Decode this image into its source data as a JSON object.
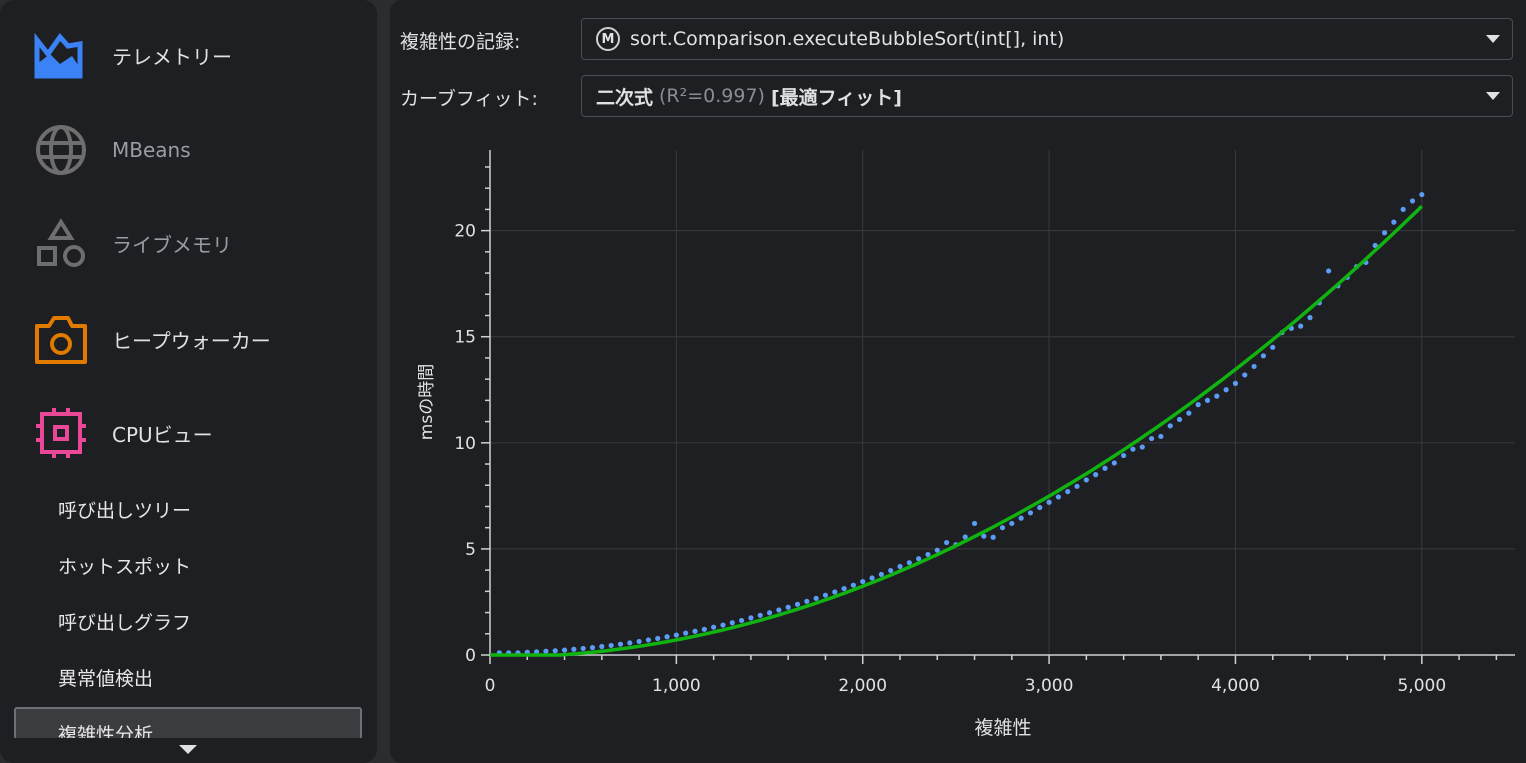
{
  "sidebar": {
    "items": [
      {
        "label": "テレメトリー",
        "icon": "telemetry-icon",
        "color": "#3b82f6"
      },
      {
        "label": "MBeans",
        "icon": "globe-icon",
        "color": "#6e6e6e"
      },
      {
        "label": "ライブメモリ",
        "icon": "shapes-icon",
        "color": "#6e6e6e"
      },
      {
        "label": "ヒープウォーカー",
        "icon": "camera-icon",
        "color": "#e07b00"
      },
      {
        "label": "CPUビュー",
        "icon": "cpu-chip-icon",
        "color": "#ec4899"
      }
    ],
    "sub_items": [
      "呼び出しツリー",
      "ホットスポット",
      "呼び出しグラフ",
      "異常値検出",
      "複雑性分析"
    ],
    "selected": "複雑性分析"
  },
  "controls": {
    "recording_label": "複雑性の記録:",
    "recording_value": "sort.Comparison.executeBubbleSort(int[], int)",
    "method_badge": "M",
    "curve_label": "カーブフィット:",
    "curve_name": "二次式",
    "curve_r2": "(R²=0.997)",
    "curve_best": "[最適フィット]"
  },
  "chart_data": {
    "type": "scatter",
    "xlabel": "複雑性",
    "ylabel": "msの時間",
    "xlim": [
      0,
      5500
    ],
    "ylim": [
      0,
      23.8
    ],
    "xticks": [
      0,
      1000,
      2000,
      3000,
      4000,
      5000
    ],
    "xtick_labels": [
      "0",
      "1,000",
      "2,000",
      "3,000",
      "4,000",
      "5,000"
    ],
    "yticks": [
      0,
      5,
      10,
      15,
      20
    ],
    "grid": true,
    "colors": {
      "points": "#5b9cf5",
      "fit": "#11b311"
    },
    "fit": {
      "model": "quadratic",
      "r2": 0.997,
      "a": 8.6e-07,
      "b": -5e-05,
      "c": -0.1
    },
    "x": [
      50,
      100,
      150,
      200,
      250,
      300,
      350,
      400,
      450,
      500,
      550,
      600,
      650,
      700,
      750,
      800,
      850,
      900,
      950,
      1000,
      1050,
      1100,
      1150,
      1200,
      1250,
      1300,
      1350,
      1400,
      1450,
      1500,
      1550,
      1600,
      1650,
      1700,
      1750,
      1800,
      1850,
      1900,
      1950,
      2000,
      2050,
      2100,
      2150,
      2200,
      2250,
      2300,
      2350,
      2400,
      2450,
      2500,
      2550,
      2600,
      2650,
      2700,
      2750,
      2800,
      2850,
      2900,
      2950,
      3000,
      3050,
      3100,
      3150,
      3200,
      3250,
      3300,
      3350,
      3400,
      3450,
      3500,
      3550,
      3600,
      3650,
      3700,
      3750,
      3800,
      3850,
      3900,
      3950,
      4000,
      4050,
      4100,
      4150,
      4200,
      4250,
      4300,
      4350,
      4400,
      4450,
      4500,
      4550,
      4600,
      4650,
      4700,
      4750,
      4800,
      4850,
      4900,
      4950,
      5000
    ],
    "y": [
      0.1,
      0.1,
      0.1,
      0.13,
      0.15,
      0.18,
      0.2,
      0.23,
      0.27,
      0.31,
      0.35,
      0.4,
      0.45,
      0.51,
      0.57,
      0.64,
      0.71,
      0.78,
      0.86,
      0.94,
      1.03,
      1.12,
      1.21,
      1.31,
      1.41,
      1.52,
      1.63,
      1.75,
      1.87,
      1.99,
      2.12,
      2.25,
      2.39,
      2.53,
      2.67,
      2.82,
      2.97,
      3.13,
      3.29,
      3.46,
      3.63,
      3.8,
      3.98,
      4.17,
      4.35,
      4.54,
      4.74,
      4.94,
      5.3,
      5.2,
      5.56,
      6.2,
      5.6,
      5.55,
      6.0,
      6.2,
      6.45,
      6.7,
      6.95,
      7.2,
      7.45,
      7.7,
      7.95,
      8.25,
      8.5,
      8.8,
      9.05,
      9.4,
      9.7,
      9.8,
      10.2,
      10.3,
      10.8,
      11.1,
      11.4,
      11.8,
      12.0,
      12.2,
      12.5,
      12.8,
      13.2,
      13.6,
      14.1,
      14.5,
      15.2,
      15.4,
      15.5,
      15.9,
      16.6,
      18.1,
      17.4,
      17.8,
      18.3,
      18.5,
      19.3,
      19.9,
      20.4,
      21.0,
      21.4,
      21.7
    ]
  }
}
